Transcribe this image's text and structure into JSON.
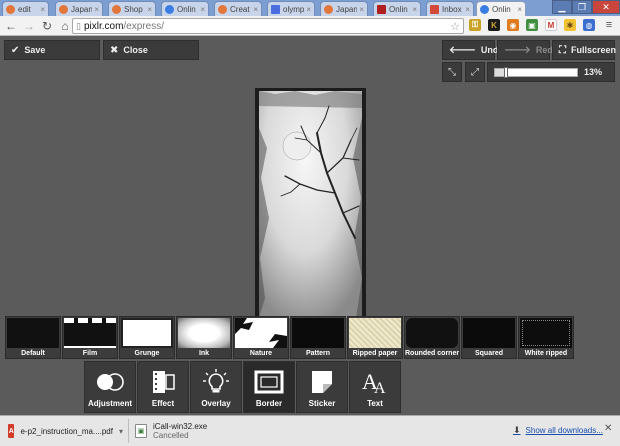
{
  "browser": {
    "tabs": [
      {
        "label": "edit",
        "fav_color": "#e3763a"
      },
      {
        "label": "Japan",
        "fav_color": "#e3763a"
      },
      {
        "label": "Shop",
        "fav_color": "#e3763a"
      },
      {
        "label": "Onlin",
        "fav_color": "#3a7ee3"
      },
      {
        "label": "Creat",
        "fav_color": "#e3763a"
      },
      {
        "label": "olymp",
        "fav_color": "#4a6ee0"
      },
      {
        "label": "Japan",
        "fav_color": "#e3763a"
      },
      {
        "label": "Onlin",
        "fav_color": "#b02020"
      },
      {
        "label": "Inbox",
        "fav_color": "#d44a3a"
      },
      {
        "label": "Onlin",
        "fav_color": "#3a7ee3"
      }
    ],
    "tab_close_glyph": "×",
    "url": {
      "host": "pixlr.com",
      "path": "/express/"
    }
  },
  "app": {
    "save_label": "Save",
    "close_label": "Close",
    "undo_label": "Undo",
    "redo_label": "Redo",
    "fullscreen_label": "Fullscreen",
    "zoom_value": "13%",
    "zoom_fraction": 0.13
  },
  "borders": [
    {
      "label": "Default"
    },
    {
      "label": "Film"
    },
    {
      "label": "Grunge"
    },
    {
      "label": "Ink"
    },
    {
      "label": "Nature"
    },
    {
      "label": "Pattern"
    },
    {
      "label": "Ripped paper"
    },
    {
      "label": "Rounded corner"
    },
    {
      "label": "Squared"
    },
    {
      "label": "White ripped"
    }
  ],
  "tools": [
    {
      "label": "Adjustment",
      "icon": "adjustment-icon"
    },
    {
      "label": "Effect",
      "icon": "film-icon"
    },
    {
      "label": "Overlay",
      "icon": "lightbulb-icon"
    },
    {
      "label": "Border",
      "icon": "frame-icon",
      "active": true
    },
    {
      "label": "Sticker",
      "icon": "sticker-icon"
    },
    {
      "label": "Text",
      "icon": "text-icon"
    }
  ],
  "downloads": [
    {
      "name": "e-p2_instruction_ma....pdf",
      "status": ""
    },
    {
      "name": "iCall-win32.exe",
      "status": "Cancelled"
    }
  ],
  "show_all_label": "Show all downloads..."
}
